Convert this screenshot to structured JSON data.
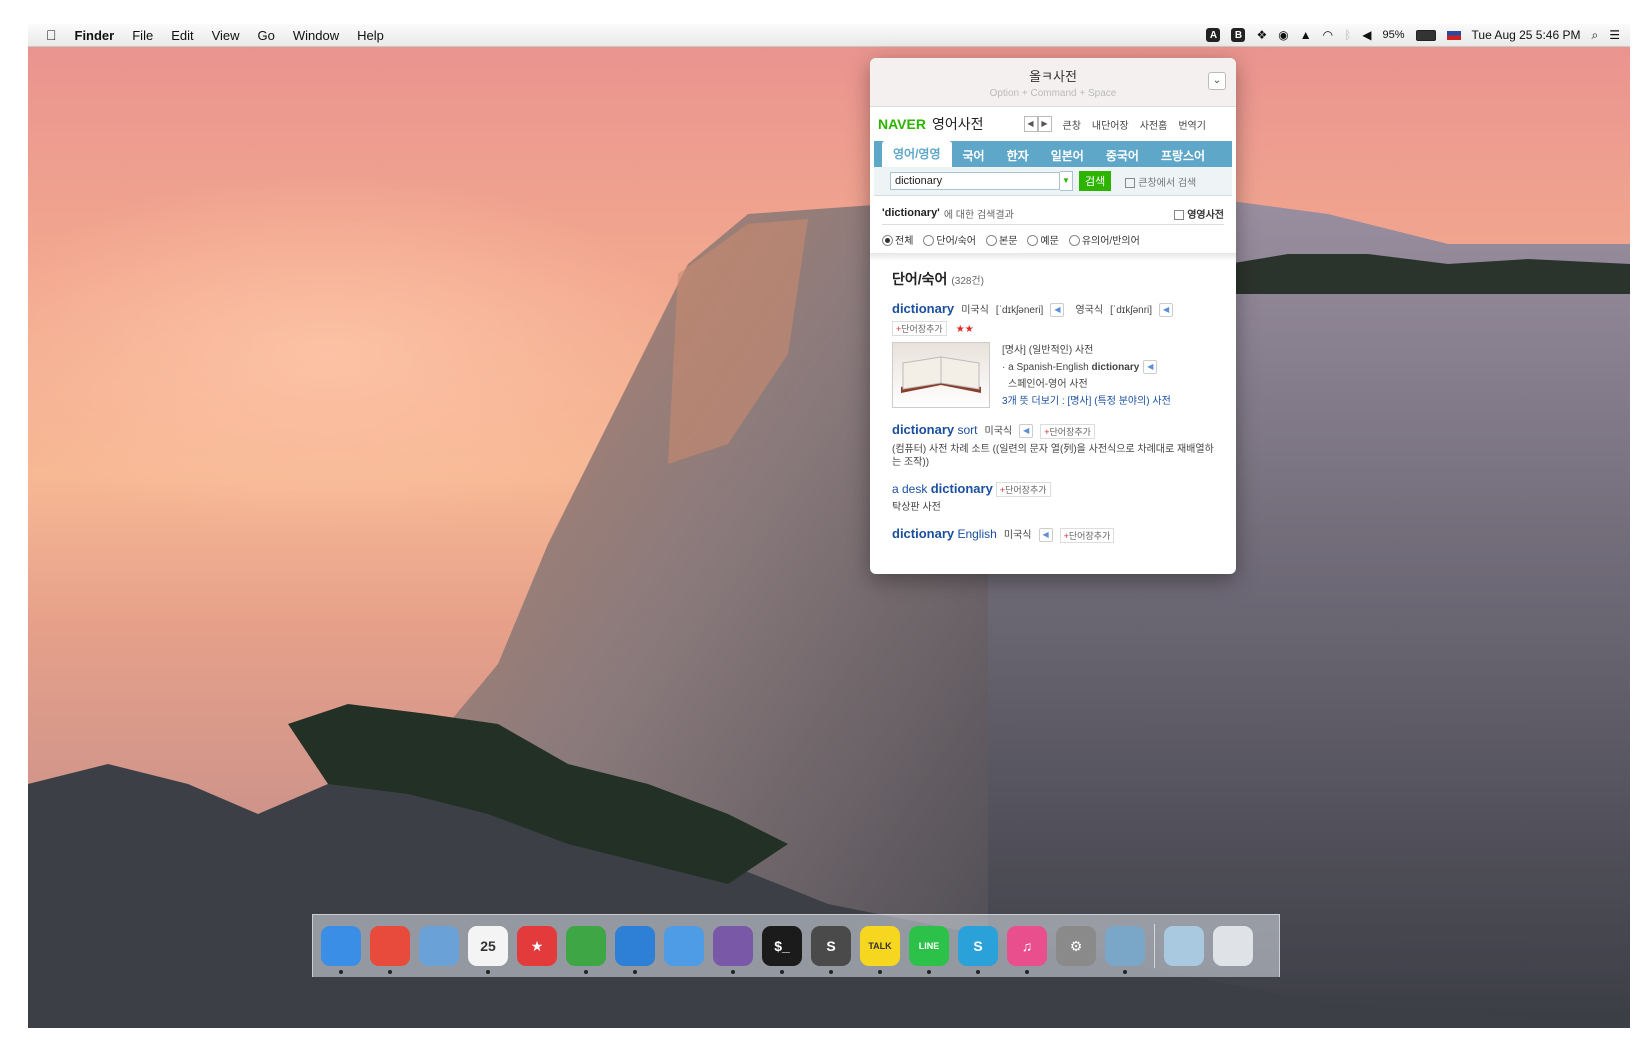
{
  "menubar": {
    "apple": "",
    "app_name": "Finder",
    "menus": [
      "File",
      "Edit",
      "View",
      "Go",
      "Window",
      "Help"
    ],
    "status_icons": [
      "dict-icon",
      "dict2-icon",
      "dropbox-icon",
      "eye-icon",
      "notification-icon",
      "wifi-icon",
      "bluetooth-icon",
      "volume-icon"
    ],
    "battery": "95%",
    "clock": "Tue Aug 25  5:46 PM"
  },
  "popup": {
    "title": "올ㅋ사전",
    "shortcut": "Option + Command + Space",
    "naver_logo": "NAVER",
    "dict_title": "영어사전",
    "links": [
      "큰창",
      "내단어장",
      "사전홈",
      "번역기"
    ],
    "tabs": [
      "영어/영영",
      "국어",
      "한자",
      "일본어",
      "중국어",
      "프랑스어"
    ],
    "search_value": "dictionary",
    "search_button": "검색",
    "bigwin_search": "큰창에서 검색",
    "result_query": "'dictionary'",
    "result_suffix": "에 대한 검색결과",
    "engeng_label": "영영사전",
    "filters": [
      "전체",
      "단어/숙어",
      "본문",
      "예문",
      "유의어/반의어"
    ],
    "section_title": "단어/숙어",
    "section_count": "(328건)",
    "entries": [
      {
        "word": "dictionary",
        "pron_us_label": "미국식",
        "pron_us": "[ˈdɪkʃəneri]",
        "pron_uk_label": "영국식",
        "pron_uk": "[ˈdɪkʃənri]",
        "add_label": "단어장추가",
        "stars": "★★",
        "def_pos": "[명사] (일반적인) 사전",
        "example_pre": "· a Spanish-English ",
        "example_word": "dictionary",
        "example_trans": "스페인어-영어 사전",
        "more": "3개 뜻 더보기 : [명사] (특정 분야의) 사전"
      },
      {
        "word": "dictionary",
        "word_rest": " sort",
        "pron_us_label": "미국식",
        "add_label": "단어장추가",
        "def": "(컴퓨터) 사전 차례 소트 ((일련의 문자 열(列)을 사전식으로 차례대로 재배열하는 조작))"
      },
      {
        "word_pre": "a desk ",
        "word": "dictionary",
        "add_label": "단어장추가",
        "def": "탁상판 사전"
      },
      {
        "word": "dictionary",
        "word_rest": " English",
        "pron_us_label": "미국식",
        "add_label": "단어장추가"
      }
    ]
  },
  "dock": {
    "apps": [
      {
        "name": "finder-icon",
        "color": "#3a8ee6",
        "label": ""
      },
      {
        "name": "chrome-icon",
        "color": "#e84a3c",
        "label": ""
      },
      {
        "name": "preview-icon",
        "color": "#6aa2d8",
        "label": ""
      },
      {
        "name": "calendar-icon",
        "color": "#f4f4f4",
        "label": "25"
      },
      {
        "name": "bookmarks-icon",
        "color": "#e33b3b",
        "label": "★"
      },
      {
        "name": "evernote-icon",
        "color": "#3ea645",
        "label": ""
      },
      {
        "name": "xcode-icon",
        "color": "#2e7fd6",
        "label": ""
      },
      {
        "name": "xcode-beta-icon",
        "color": "#4e9be6",
        "label": ""
      },
      {
        "name": "github-icon",
        "color": "#7a58a8",
        "label": ""
      },
      {
        "name": "terminal-icon",
        "color": "#1b1b1b",
        "label": "$_"
      },
      {
        "name": "sublime-icon",
        "color": "#4a4a4a",
        "label": "S"
      },
      {
        "name": "kakaotalk-icon",
        "color": "#f7d61f",
        "label": "TALK"
      },
      {
        "name": "line-icon",
        "color": "#2cc24a",
        "label": "LINE"
      },
      {
        "name": "slides-icon",
        "color": "#2aa1d8",
        "label": "S"
      },
      {
        "name": "itunes-icon",
        "color": "#e84f8c",
        "label": "♫"
      },
      {
        "name": "system-preferences-icon",
        "color": "#8a8a8a",
        "label": "⚙"
      },
      {
        "name": "image-viewer-icon",
        "color": "#7aa6c8",
        "label": ""
      },
      {
        "name": "downloads-folder-icon",
        "color": "#a9c9e0",
        "label": ""
      },
      {
        "name": "trash-icon",
        "color": "#dfe3e8",
        "label": ""
      }
    ]
  },
  "colors": {
    "naver_green": "#2db400",
    "tab_blue": "#5fa7c8",
    "link_blue": "#1b4fa0"
  }
}
